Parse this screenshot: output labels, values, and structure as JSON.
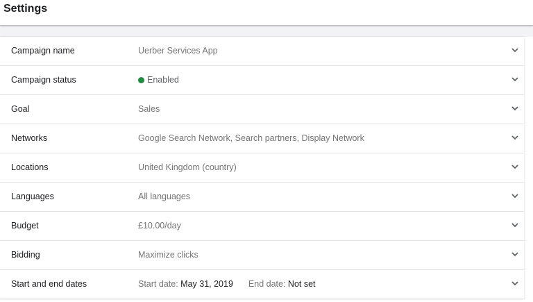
{
  "page": {
    "title": "Settings"
  },
  "colors": {
    "status_enabled": "#1e8e3e",
    "label_text": "#202124",
    "value_text": "#757575"
  },
  "rows": [
    {
      "label": "Campaign name",
      "value": "Uerber Services App",
      "icon": "chevron-down-icon"
    },
    {
      "label": "Campaign status",
      "value": "Enabled",
      "icon": "chevron-down-icon"
    },
    {
      "label": "Goal",
      "value": "Sales",
      "icon": "chevron-down-icon"
    },
    {
      "label": "Networks",
      "value": "Google Search Network, Search partners, Display Network",
      "icon": "chevron-down-icon"
    },
    {
      "label": "Locations",
      "value": "United Kingdom (country)",
      "icon": "chevron-down-icon"
    },
    {
      "label": "Languages",
      "value": "All languages",
      "icon": "chevron-down-icon"
    },
    {
      "label": "Budget",
      "value": "£10.00/day",
      "icon": "chevron-down-icon"
    },
    {
      "label": "Bidding",
      "value": "Maximize clicks",
      "icon": "chevron-down-icon"
    },
    {
      "label": "Start and end dates",
      "start_label": "Start date:",
      "start_value": "May 31, 2019",
      "end_label": "End date:",
      "end_value": "Not set",
      "icon": "chevron-down-icon"
    }
  ]
}
